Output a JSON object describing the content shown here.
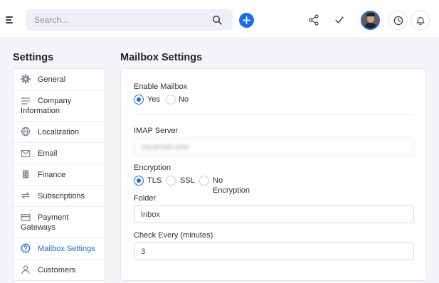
{
  "topbar": {
    "search_placeholder": "Search...",
    "icons": [
      "menu-icon",
      "search-icon",
      "plus-icon",
      "share-icon",
      "check-icon",
      "avatar",
      "clock-icon",
      "bell-icon"
    ],
    "accent_color": "#1a6cf0"
  },
  "sidebar": {
    "title": "Settings",
    "items": [
      {
        "label": "General",
        "icon": "gear-icon"
      },
      {
        "label": "Company Information",
        "icon": "list-icon"
      },
      {
        "label": "Localization",
        "icon": "globe-icon"
      },
      {
        "label": "Email",
        "icon": "envelope-icon"
      },
      {
        "label": "Finance",
        "icon": "building-icon"
      },
      {
        "label": "Subscriptions",
        "icon": "refresh-icon"
      },
      {
        "label": "Payment Gateways",
        "icon": "credit-card-icon"
      },
      {
        "label": "Mailbox Settings",
        "icon": "help-circle-icon",
        "active": true
      },
      {
        "label": "Customers",
        "icon": "user-icon"
      }
    ]
  },
  "main": {
    "title": "Mailbox Settings",
    "enable_mailbox": {
      "label": "Enable Mailbox",
      "options": [
        "Yes",
        "No"
      ],
      "selected": "Yes"
    },
    "imap_server": {
      "label": "IMAP Server",
      "value": "my.email.com"
    },
    "encryption": {
      "label": "Encryption",
      "options": [
        "TLS",
        "SSL",
        "No Encryption"
      ],
      "selected": "TLS"
    },
    "folder": {
      "label": "Folder",
      "value": "Inbox"
    },
    "check_every": {
      "label": "Check Every (minutes)",
      "value": "3"
    }
  }
}
